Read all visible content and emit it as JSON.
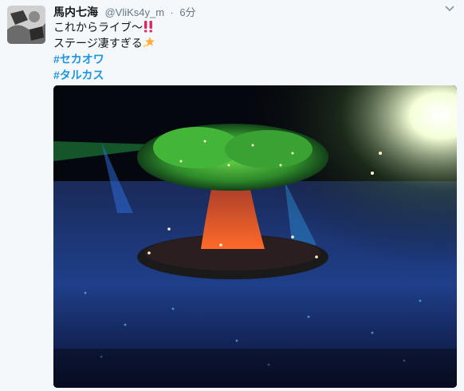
{
  "tweet": {
    "display_name": "馬内七海",
    "handle": "@VliKs4y_m",
    "separator": "·",
    "time": "6分",
    "line1": "これからライブ〜",
    "line2": "ステージ凄すぎる",
    "hashtags": [
      "#セカオワ",
      "#タルカス"
    ]
  },
  "icons": {
    "caret": "chevron-down-icon",
    "emoji1": "double-exclamation-icon",
    "emoji2": "dizzy-star-icon"
  },
  "colors": {
    "link": "#1b95e0",
    "secondary_text": "#657786",
    "background": "#f5f8fa",
    "exclamation": "#e0245e"
  }
}
